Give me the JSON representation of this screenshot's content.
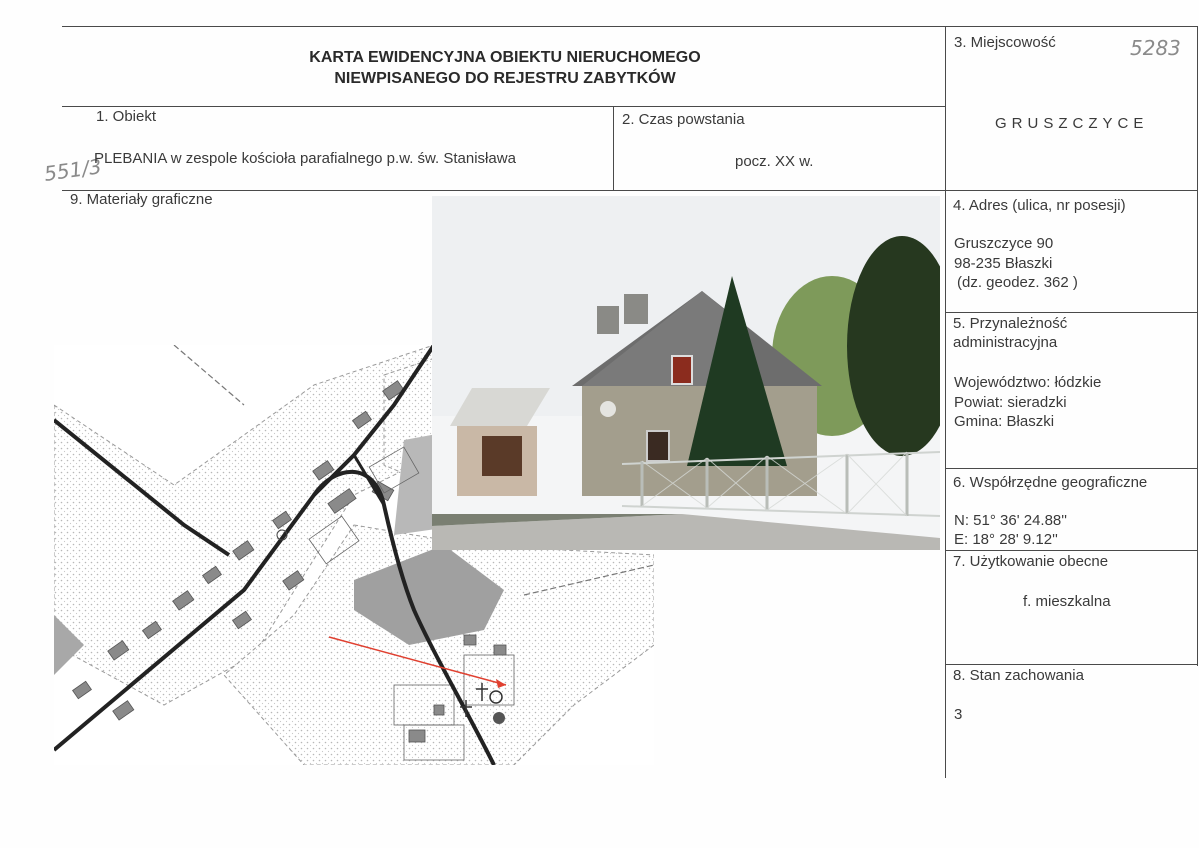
{
  "header": {
    "title_line1": "KARTA EWIDENCYJNA OBIEKTU NIERUCHOMEGO",
    "title_line2": "NIEWPISANEGO DO REJESTRU ZABYTKÓW"
  },
  "handwritten": {
    "card_number": "5283",
    "object_number": "551/3"
  },
  "fields": {
    "f1": {
      "label": "1.  Obiekt",
      "value_main": "PLEBANIA",
      "value_rest": "w zespole kościoła parafialnego p.w. św. Stanisława"
    },
    "f2": {
      "label": "2. Czas powstania",
      "value": "pocz. XX w."
    },
    "f3": {
      "label": "3. Miejscowość",
      "value": "GRUSZCZYCE"
    },
    "f4": {
      "label": "4. Adres (ulica, nr posesji)",
      "line1": "Gruszczyce 90",
      "line2": "98-235  Błaszki",
      "line3": "(dz. geodez. 362 )"
    },
    "f5": {
      "label_line1": "5. Przynależność",
      "label_line2": "administracyjna",
      "line1": "Województwo: łódzkie",
      "line2": "Powiat: sieradzki",
      "line3": "Gmina: Błaszki"
    },
    "f6": {
      "label": "6. Współrzędne geograficzne",
      "line1": "N: 51° 36' 24.88''",
      "line2": "E: 18° 28' 9.12''"
    },
    "f7": {
      "label": "7. Użytkowanie obecne",
      "value": "f. mieszkalna"
    },
    "f8": {
      "label": "8. Stan zachowania",
      "value": "3"
    },
    "f9": {
      "label": "9. Materiały graficzne"
    }
  }
}
